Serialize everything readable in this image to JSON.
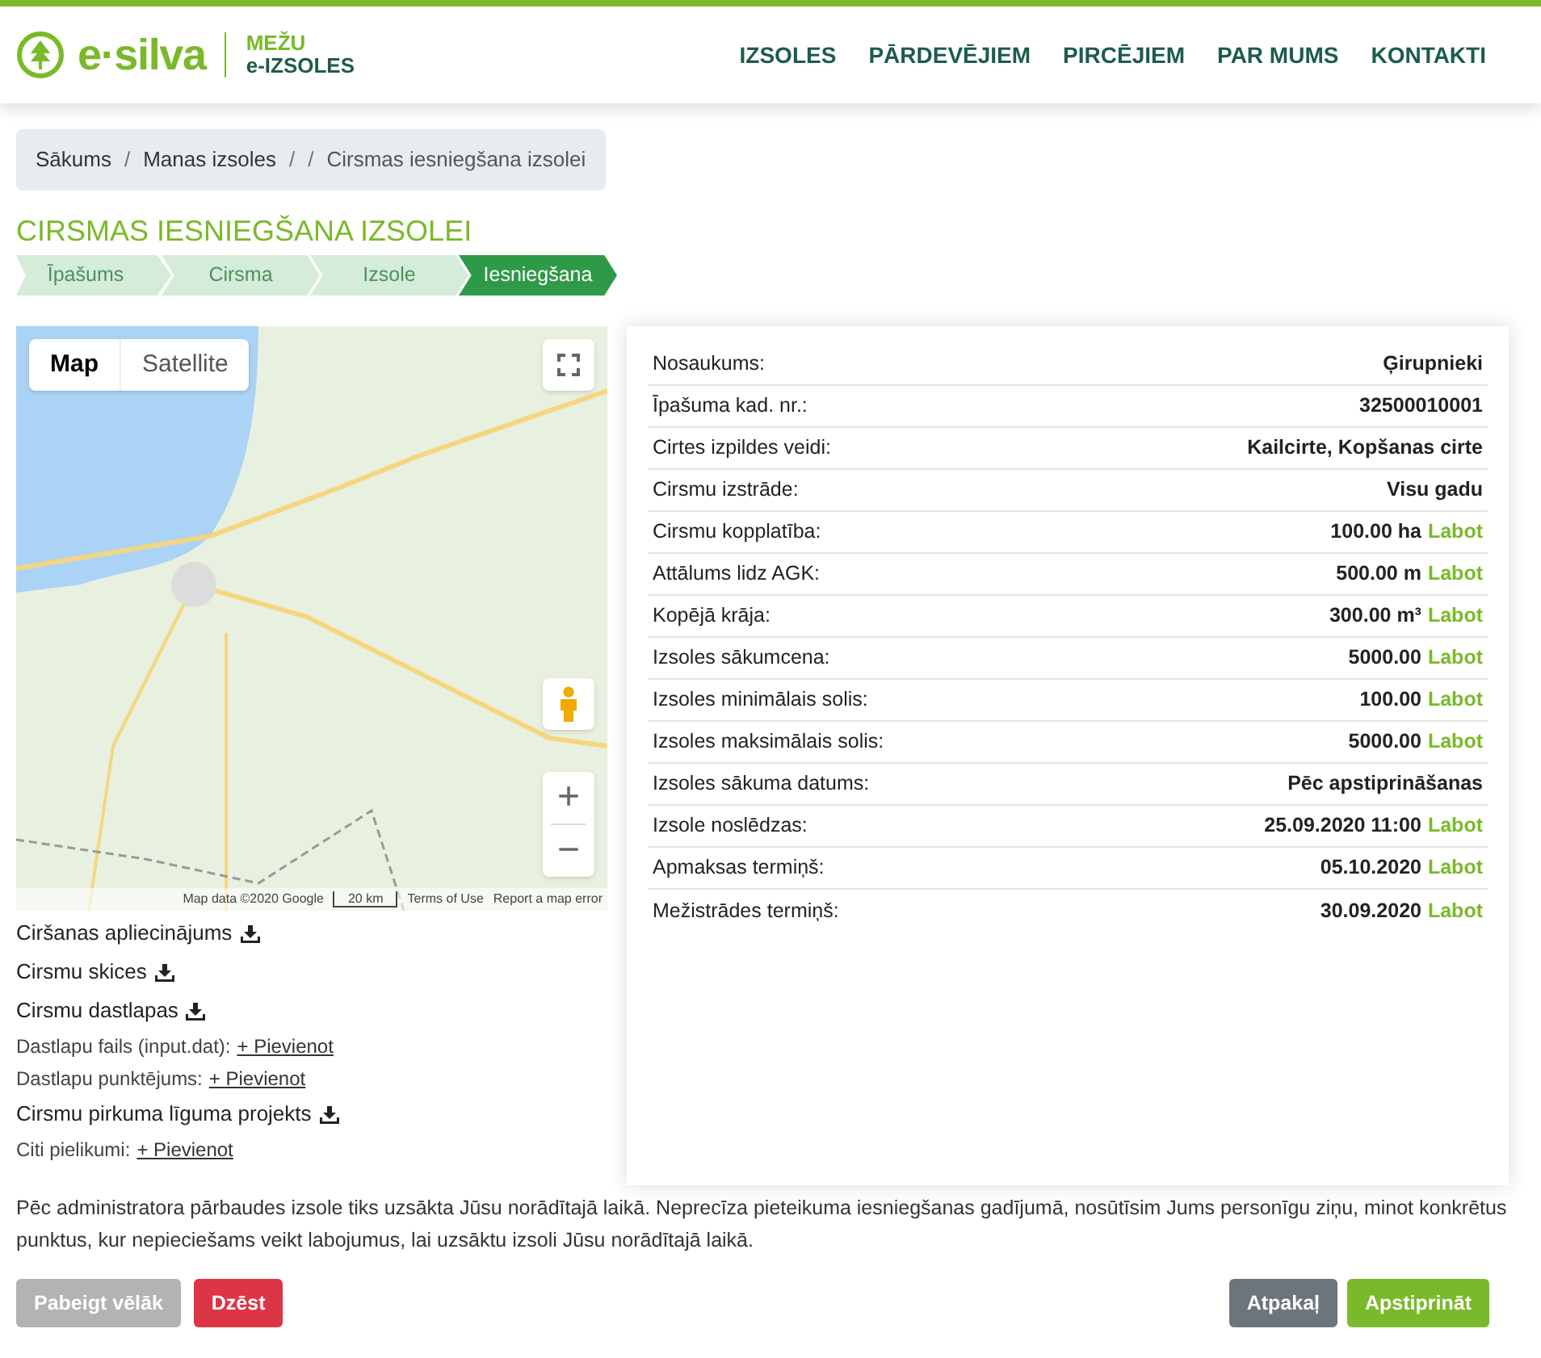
{
  "logo": {
    "brand": "e·silva",
    "subtitle_1": "MEŽU",
    "subtitle_2": "e-IZSOLES"
  },
  "nav": [
    "IZSOLES",
    "PĀRDEVĒJIEM",
    "PIRCĒJIEM",
    "PAR MUMS",
    "KONTAKTI"
  ],
  "breadcrumb": [
    {
      "kind": "link",
      "label": "Sākums"
    },
    {
      "kind": "separator",
      "label": "/"
    },
    {
      "kind": "link",
      "label": "Manas izsoles"
    },
    {
      "kind": "separator",
      "label": "/"
    },
    {
      "kind": "separator",
      "label": "/"
    },
    {
      "kind": "link",
      "label": "Cirsmas iesniegšana izsolei"
    }
  ],
  "title": "CIRSMAS IESNIEGŠANA IZSOLEI",
  "steps": [
    {
      "label": "Īpašums",
      "selected": false
    },
    {
      "label": "Cirsma",
      "selected": false
    },
    {
      "label": "Izsole",
      "selected": false
    },
    {
      "label": "Iesniegšana",
      "selected": true
    }
  ],
  "map": {
    "types": [
      {
        "label": "Map",
        "selected": true
      },
      {
        "label": "Satellite",
        "selected": false
      }
    ],
    "zoom_in": "+",
    "zoom_out": "−",
    "attribution": "Map data ©2020 Google",
    "scale": "20 km",
    "terms": "Terms of Use",
    "report": "Report a map error"
  },
  "documents": [
    {
      "kind": "download",
      "label": "Ciršanas apliecinājums"
    },
    {
      "kind": "download",
      "label": "Cirsmu skices"
    },
    {
      "kind": "download",
      "label": "Cirsmu dastlapas"
    },
    {
      "kind": "add",
      "label": "Dastlapu fails (input.dat):",
      "link": "+ Pievienot"
    },
    {
      "kind": "add",
      "label": "Dastlapu punktējums:",
      "link": "+ Pievienot"
    },
    {
      "kind": "download",
      "label": "Cirsmu pirkuma līguma projekts"
    },
    {
      "kind": "add",
      "label": "Citi pielikumi:",
      "link": "+ Pievienot"
    }
  ],
  "details": [
    {
      "label": "Nosaukums:",
      "value": "Ģirupnieki"
    },
    {
      "label": "Īpašuma kad. nr.:",
      "value": "32500010001"
    },
    {
      "label": "Cirtes izpildes veidi:",
      "value": "Kailcirte, Kopšanas cirte"
    },
    {
      "label": "Cirsmu izstrāde:",
      "value": "Visu gadu"
    },
    {
      "label": "Cirsmu kopplatība:",
      "value": "100.00 ha",
      "edit": "Labot"
    },
    {
      "label": "Attālums lidz AGK:",
      "value": "500.00 m",
      "edit": "Labot"
    },
    {
      "label": "Kopējā krāja:",
      "value": "300.00 m³",
      "edit": "Labot"
    },
    {
      "label": "Izsoles sākumcena:",
      "value": "5000.00",
      "edit": "Labot"
    },
    {
      "label": "Izsoles minimālais solis:",
      "value": "100.00",
      "edit": "Labot"
    },
    {
      "label": "Izsoles maksimālais solis:",
      "value": "5000.00",
      "edit": "Labot"
    },
    {
      "label": "Izsoles sākuma datums:",
      "value": "Pēc apstiprināšanas"
    },
    {
      "label": "Izsole noslēdzas:",
      "value": "25.09.2020 11:00",
      "edit": "Labot"
    },
    {
      "label": "Apmaksas termiņš:",
      "value": "05.10.2020",
      "edit": "Labot"
    },
    {
      "label": "Mežistrādes termiņš:",
      "value": "30.09.2020",
      "edit": "Labot"
    }
  ],
  "note": "Pēc administratora pārbaudes izsole tiks uzsākta Jūsu norādītajā laikā. Neprecīza pieteikuma iesniegšanas gadījumā, nosūtīsim Jums personīgu ziņu, minot konkrētus punktus, kur nepieciešams veikt labojumus, lai uzsāktu izsoli Jūsu norādītajā laikā.",
  "buttons_left": [
    {
      "kind": "secondary",
      "label": "Pabeigt vēlāk"
    },
    {
      "kind": "danger",
      "label": "Dzēst"
    }
  ],
  "buttons_right": [
    {
      "kind": "dark",
      "label": "Atpakaļ"
    },
    {
      "kind": "primary",
      "label": "Apstiprināt"
    }
  ]
}
